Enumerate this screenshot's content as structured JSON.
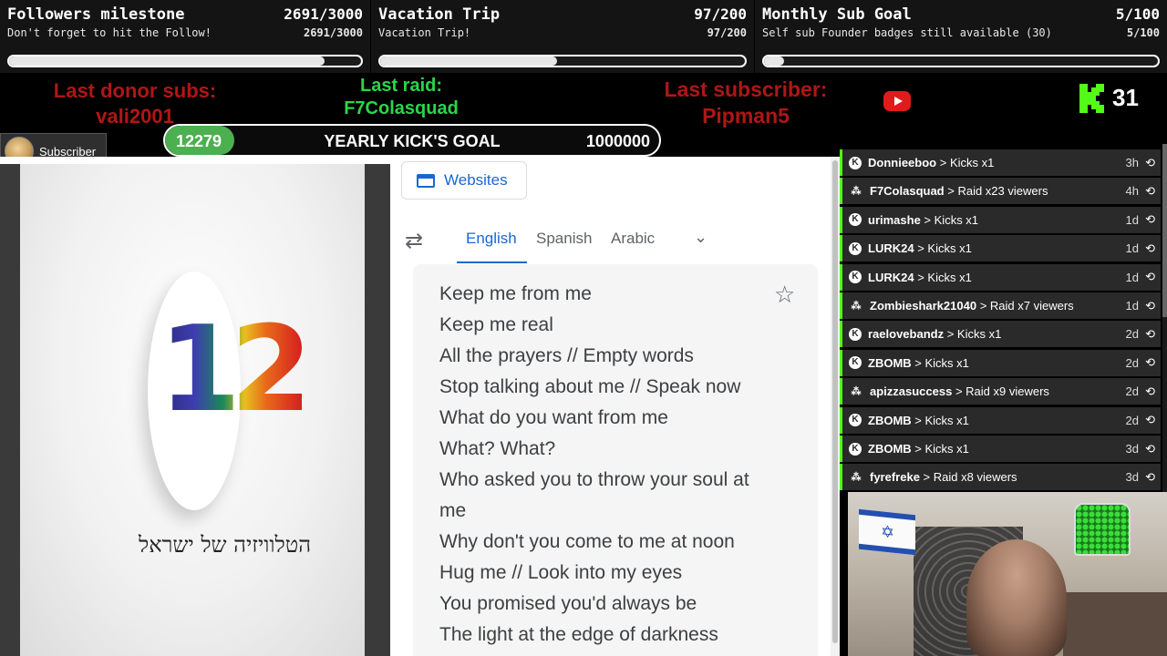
{
  "goals": [
    {
      "title": "Followers milestone",
      "count": "2691/3000",
      "subtitle": "Don't forget to hit the Follow!",
      "count_small": "2691/3000",
      "progress": 0.897
    },
    {
      "title": "Vacation Trip",
      "count": "97/200",
      "subtitle": "Vacation Trip!",
      "count_small": "97/200",
      "progress": 0.485
    },
    {
      "title": "Monthly Sub Goal",
      "count": "5/100",
      "subtitle": "Self sub Founder badges still available (30)",
      "count_small": "5/100",
      "progress": 0.05
    }
  ],
  "info": {
    "last_donor_label": "Last donor subs:",
    "last_donor_name": "vali2001",
    "last_raid_label": "Last raid:",
    "last_raid_name": "F7Colasquad",
    "last_sub_label": "Last subscriber:",
    "last_sub_name": "Pipman5",
    "kick_count": "31",
    "youtube_icon": "youtube-icon",
    "kick_icon": "kick-logo-icon"
  },
  "yearly_goal": {
    "current": "12279",
    "title": "YEARLY KICK'S GOAL",
    "target": "1000000",
    "progress": 0.0123
  },
  "subscriber_tag": {
    "label": "Subscriber"
  },
  "browser": {
    "websites_label": "Websites",
    "tabs": [
      "English",
      "Spanish",
      "Arabic"
    ],
    "active_tab": "English",
    "logo_number": "12",
    "logo_caption": "הטלוויזיה של ישראל",
    "lyrics": [
      "Keep me from me",
      "Keep me real",
      "All the prayers // Empty words",
      "Stop talking about me // Speak now",
      "What do you want from me",
      "What? What?",
      "Who asked you to throw your soul at",
      "me",
      "Why don't you come to me at noon",
      "Hug me // Look into my eyes",
      "You promised you'd always be",
      "The light at the edge of darkness"
    ]
  },
  "feed": [
    {
      "user": "Donnieeboo",
      "action": "Kicks x1",
      "time": "3h",
      "kind": "kick"
    },
    {
      "user": "F7Colasquad",
      "action": "Raid x23 viewers",
      "time": "4h",
      "kind": "raid"
    },
    {
      "user": "urimashe",
      "action": "Kicks x1",
      "time": "1d",
      "kind": "kick"
    },
    {
      "user": "LURK24",
      "action": "Kicks x1",
      "time": "1d",
      "kind": "kick"
    },
    {
      "user": "LURK24",
      "action": "Kicks x1",
      "time": "1d",
      "kind": "kick"
    },
    {
      "user": "Zombieshark21040",
      "action": "Raid x7 viewers",
      "time": "1d",
      "kind": "raid"
    },
    {
      "user": "raelovebandz",
      "action": "Kicks x1",
      "time": "2d",
      "kind": "kick"
    },
    {
      "user": "ZBOMB",
      "action": "Kicks x1",
      "time": "2d",
      "kind": "kick"
    },
    {
      "user": "apizzasuccess",
      "action": "Raid x9 viewers",
      "time": "2d",
      "kind": "raid"
    },
    {
      "user": "ZBOMB",
      "action": "Kicks x1",
      "time": "2d",
      "kind": "kick"
    },
    {
      "user": "ZBOMB",
      "action": "Kicks x1",
      "time": "3d",
      "kind": "kick"
    },
    {
      "user": "fyrefreke",
      "action": "Raid x8 viewers",
      "time": "3d",
      "kind": "raid"
    }
  ],
  "colors": {
    "kick_green": "#53fc18",
    "donor_red": "#b01616",
    "raid_green": "#2bd64a",
    "google_blue": "#1967d2"
  }
}
